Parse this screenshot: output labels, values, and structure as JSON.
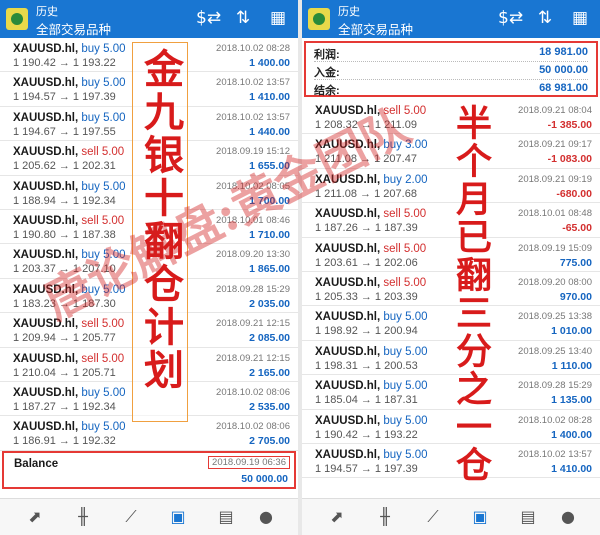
{
  "colors": {
    "header": "#1976d2",
    "buy": "#1565c0",
    "sell": "#d32f2f",
    "profit_pos": "#1565c0",
    "profit_neg": "#d32f2f",
    "highlight": "#e53935"
  },
  "left": {
    "header": {
      "subtitle": "历史",
      "title": "全部交易品种"
    },
    "header_icons": [
      "currency-exchange-icon",
      "sort-icon",
      "calendar-icon"
    ],
    "rows": [
      {
        "symbol": "XAUUSD.hl,",
        "action": "buy 5.00",
        "side": "buy",
        "prices": "1 190.42 → 1 193.22",
        "time": "2018.10.02 08:28",
        "profit": "1 400.00"
      },
      {
        "symbol": "XAUUSD.hl,",
        "action": "buy 5.00",
        "side": "buy",
        "prices": "1 194.57 → 1 197.39",
        "time": "2018.10.02 13:57",
        "profit": "1 410.00"
      },
      {
        "symbol": "XAUUSD.hl,",
        "action": "buy 5.00",
        "side": "buy",
        "prices": "1 194.67 → 1 197.55",
        "time": "2018.10.02 13:57",
        "profit": "1 440.00"
      },
      {
        "symbol": "XAUUSD.hl,",
        "action": "sell 5.00",
        "side": "sell",
        "prices": "1 205.62 → 1 202.31",
        "time": "2018.09.19 15:12",
        "profit": "1 655.00"
      },
      {
        "symbol": "XAUUSD.hl,",
        "action": "buy 5.00",
        "side": "buy",
        "prices": "1 188.94 → 1 192.34",
        "time": "2018.10.02 08:05",
        "profit": "1 700.00"
      },
      {
        "symbol": "XAUUSD.hl,",
        "action": "sell 5.00",
        "side": "sell",
        "prices": "1 190.80 → 1 187.38",
        "time": "2018.10.01 08:46",
        "profit": "1 710.00"
      },
      {
        "symbol": "XAUUSD.hl,",
        "action": "buy 5.00",
        "side": "buy",
        "prices": "1 203.37 → 1 207.10",
        "time": "2018.09.20 13:30",
        "profit": "1 865.00"
      },
      {
        "symbol": "XAUUSD.hl,",
        "action": "buy 5.00",
        "side": "buy",
        "prices": "1 183.23 → 1 187.30",
        "time": "2018.09.28 15:29",
        "profit": "2 035.00"
      },
      {
        "symbol": "XAUUSD.hl,",
        "action": "sell 5.00",
        "side": "sell",
        "prices": "1 209.94 → 1 205.77",
        "time": "2018.09.21 12:15",
        "profit": "2 085.00"
      },
      {
        "symbol": "XAUUSD.hl,",
        "action": "sell 5.00",
        "side": "sell",
        "prices": "1 210.04 → 1 205.71",
        "time": "2018.09.21 12:15",
        "profit": "2 165.00"
      },
      {
        "symbol": "XAUUSD.hl,",
        "action": "buy 5.00",
        "side": "buy",
        "prices": "1 187.27 → 1 192.34",
        "time": "2018.10.02 08:06",
        "profit": "2 535.00"
      },
      {
        "symbol": "XAUUSD.hl,",
        "action": "buy 5.00",
        "side": "buy",
        "prices": "1 186.91 → 1 192.32",
        "time": "2018.10.02 08:06",
        "profit": "2 705.00"
      }
    ],
    "balance": {
      "label": "Balance",
      "time": "2018.09.19 06:36",
      "value": "50 000.00"
    },
    "overlay_text": "金九银十翻仓计划"
  },
  "right": {
    "header": {
      "subtitle": "历史",
      "title": "全部交易品种"
    },
    "summary": [
      {
        "label": "利润:",
        "value": "18 981.00"
      },
      {
        "label": "入金:",
        "value": "50 000.00"
      },
      {
        "label": "结余:",
        "value": "68 981.00"
      }
    ],
    "rows": [
      {
        "symbol": "XAUUSD.hl,",
        "action": "sell 5.00",
        "side": "sell",
        "prices": "1 208.32 → 1 211.09",
        "time": "2018.09.21 08:04",
        "profit": "-1 385.00",
        "sign": "neg"
      },
      {
        "symbol": "XAUUSD.hl,",
        "action": "buy 3.00",
        "side": "buy",
        "prices": "1 211.08 → 1 207.47",
        "time": "2018.09.21 09:17",
        "profit": "-1 083.00",
        "sign": "neg"
      },
      {
        "symbol": "XAUUSD.hl,",
        "action": "buy 2.00",
        "side": "buy",
        "prices": "1 211.08 → 1 207.68",
        "time": "2018.09.21 09:19",
        "profit": "-680.00",
        "sign": "neg"
      },
      {
        "symbol": "XAUUSD.hl,",
        "action": "sell 5.00",
        "side": "sell",
        "prices": "1 187.26 → 1 187.39",
        "time": "2018.10.01 08:48",
        "profit": "-65.00",
        "sign": "neg"
      },
      {
        "symbol": "XAUUSD.hl,",
        "action": "sell 5.00",
        "side": "sell",
        "prices": "1 203.61 → 1 202.06",
        "time": "2018.09.19 15:09",
        "profit": "775.00",
        "sign": "pos"
      },
      {
        "symbol": "XAUUSD.hl,",
        "action": "sell 5.00",
        "side": "sell",
        "prices": "1 205.33 → 1 203.39",
        "time": "2018.09.20 08:00",
        "profit": "970.00",
        "sign": "pos"
      },
      {
        "symbol": "XAUUSD.hl,",
        "action": "buy 5.00",
        "side": "buy",
        "prices": "1 198.92 → 1 200.94",
        "time": "2018.09.25 13:38",
        "profit": "1 010.00",
        "sign": "pos"
      },
      {
        "symbol": "XAUUSD.hl,",
        "action": "buy 5.00",
        "side": "buy",
        "prices": "1 198.31 → 1 200.53",
        "time": "2018.09.25 13:40",
        "profit": "1 110.00",
        "sign": "pos"
      },
      {
        "symbol": "XAUUSD.hl,",
        "action": "buy 5.00",
        "side": "buy",
        "prices": "1 185.04 → 1 187.31",
        "time": "2018.09.28 15:29",
        "profit": "1 135.00",
        "sign": "pos"
      },
      {
        "symbol": "XAUUSD.hl,",
        "action": "buy 5.00",
        "side": "buy",
        "prices": "1 190.42 → 1 193.22",
        "time": "2018.10.02 08:28",
        "profit": "1 400.00",
        "sign": "pos"
      },
      {
        "symbol": "XAUUSD.hl,",
        "action": "buy 5.00",
        "side": "buy",
        "prices": "1 194.57 → 1 197.39",
        "time": "2018.10.02 13:57",
        "profit": "1 410.00",
        "sign": "pos"
      }
    ],
    "overlay_text": "半个月已翻三分之一仓"
  },
  "tabbar_icons": [
    "trade-icon",
    "chart-candles-icon",
    "analytics-icon",
    "history-icon",
    "news-icon",
    "chat-icon"
  ],
  "watermark": "唐论解盘:黄金团队"
}
